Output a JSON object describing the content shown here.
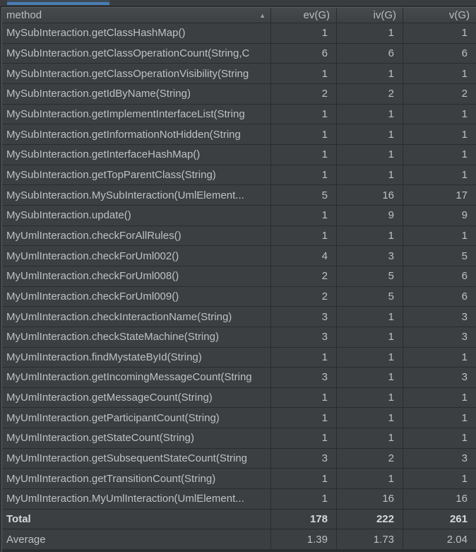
{
  "header": {
    "sort_icon": "▲",
    "columns": [
      {
        "label": "method"
      },
      {
        "label": "ev(G)"
      },
      {
        "label": "iv(G)"
      },
      {
        "label": "v(G)"
      }
    ]
  },
  "rows": [
    {
      "method": "MySubInteraction.getClassHashMap()",
      "ev": 1,
      "iv": 1,
      "v": 1
    },
    {
      "method": "MySubInteraction.getClassOperationCount(String,C",
      "ev": 6,
      "iv": 6,
      "v": 6
    },
    {
      "method": "MySubInteraction.getClassOperationVisibility(String",
      "ev": 1,
      "iv": 1,
      "v": 1
    },
    {
      "method": "MySubInteraction.getIdByName(String)",
      "ev": 2,
      "iv": 2,
      "v": 2
    },
    {
      "method": "MySubInteraction.getImplementInterfaceList(String",
      "ev": 1,
      "iv": 1,
      "v": 1
    },
    {
      "method": "MySubInteraction.getInformationNotHidden(String",
      "ev": 1,
      "iv": 1,
      "v": 1
    },
    {
      "method": "MySubInteraction.getInterfaceHashMap()",
      "ev": 1,
      "iv": 1,
      "v": 1
    },
    {
      "method": "MySubInteraction.getTopParentClass(String)",
      "ev": 1,
      "iv": 1,
      "v": 1
    },
    {
      "method": "MySubInteraction.MySubInteraction(UmlElement...",
      "ev": 5,
      "iv": 16,
      "v": 17
    },
    {
      "method": "MySubInteraction.update()",
      "ev": 1,
      "iv": 9,
      "v": 9
    },
    {
      "method": "MyUmlInteraction.checkForAllRules()",
      "ev": 1,
      "iv": 1,
      "v": 1
    },
    {
      "method": "MyUmlInteraction.checkForUml002()",
      "ev": 4,
      "iv": 3,
      "v": 5
    },
    {
      "method": "MyUmlInteraction.checkForUml008()",
      "ev": 2,
      "iv": 5,
      "v": 6
    },
    {
      "method": "MyUmlInteraction.checkForUml009()",
      "ev": 2,
      "iv": 5,
      "v": 6
    },
    {
      "method": "MyUmlInteraction.checkInteractionName(String)",
      "ev": 3,
      "iv": 1,
      "v": 3
    },
    {
      "method": "MyUmlInteraction.checkStateMachine(String)",
      "ev": 3,
      "iv": 1,
      "v": 3
    },
    {
      "method": "MyUmlInteraction.findMystateById(String)",
      "ev": 1,
      "iv": 1,
      "v": 1
    },
    {
      "method": "MyUmlInteraction.getIncomingMessageCount(String",
      "ev": 3,
      "iv": 1,
      "v": 3
    },
    {
      "method": "MyUmlInteraction.getMessageCount(String)",
      "ev": 1,
      "iv": 1,
      "v": 1
    },
    {
      "method": "MyUmlInteraction.getParticipantCount(String)",
      "ev": 1,
      "iv": 1,
      "v": 1
    },
    {
      "method": "MyUmlInteraction.getStateCount(String)",
      "ev": 1,
      "iv": 1,
      "v": 1
    },
    {
      "method": "MyUmlInteraction.getSubsequentStateCount(String",
      "ev": 3,
      "iv": 2,
      "v": 3
    },
    {
      "method": "MyUmlInteraction.getTransitionCount(String)",
      "ev": 1,
      "iv": 1,
      "v": 1
    },
    {
      "method": "MyUmlInteraction.MyUmlInteraction(UmlElement...",
      "ev": 1,
      "iv": 16,
      "v": 16
    }
  ],
  "summary": {
    "total": {
      "label": "Total",
      "ev": 178,
      "iv": 222,
      "v": 261
    },
    "average": {
      "label": "Average",
      "ev": "1.39",
      "iv": "1.73",
      "v": "2.04"
    }
  },
  "colors": {
    "background": "#3c3f41",
    "gridline": "#2a2c2e",
    "text": "#bdc1c4",
    "header_top": "#474a4c",
    "tab_indicator_blue": "#4a7db3"
  }
}
